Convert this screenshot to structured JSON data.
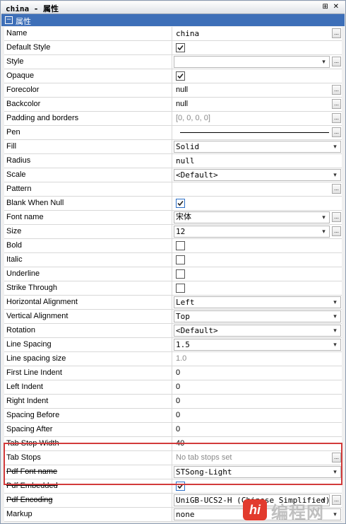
{
  "window": {
    "title": "china - 属性",
    "icons": "⊞ ✕"
  },
  "section": {
    "label": "属性"
  },
  "properties": [
    {
      "name": "Name",
      "kind": "text",
      "value": "china",
      "mono": true,
      "ellipsis": true
    },
    {
      "name": "Default Style",
      "kind": "check",
      "checked": true
    },
    {
      "name": "Style",
      "kind": "combo",
      "value": "",
      "ellipsis": true
    },
    {
      "name": "Opaque",
      "kind": "check",
      "checked": true
    },
    {
      "name": "Forecolor",
      "kind": "text",
      "value": "null",
      "ellipsis": true
    },
    {
      "name": "Backcolor",
      "kind": "text",
      "value": "null",
      "ellipsis": true
    },
    {
      "name": "Padding and borders",
      "kind": "text",
      "value": "[0, 0, 0, 0]",
      "gray": true,
      "ellipsis": true
    },
    {
      "name": "Pen",
      "kind": "pen",
      "ellipsis": true
    },
    {
      "name": "Fill",
      "kind": "combo",
      "value": "Solid",
      "mono": true
    },
    {
      "name": "Radius",
      "kind": "text",
      "value": "null",
      "mono": true
    },
    {
      "name": "Scale",
      "kind": "combo",
      "value": "<Default>",
      "mono": true
    },
    {
      "name": "Pattern",
      "kind": "text",
      "value": "",
      "ellipsis": true
    },
    {
      "name": "Blank When Null",
      "kind": "check",
      "checked": true,
      "blue": true
    },
    {
      "name": "Font name",
      "kind": "combo",
      "value": "宋体",
      "ellipsis": true
    },
    {
      "name": "Size",
      "kind": "combo",
      "value": "12",
      "mono": true,
      "ellipsis": true
    },
    {
      "name": "Bold",
      "kind": "check",
      "checked": false
    },
    {
      "name": "Italic",
      "kind": "check",
      "checked": false
    },
    {
      "name": "Underline",
      "kind": "check",
      "checked": false
    },
    {
      "name": "Strike Through",
      "kind": "check",
      "checked": false
    },
    {
      "name": "Horizontal Alignment",
      "kind": "combo",
      "value": "Left",
      "mono": true
    },
    {
      "name": "Vertical Alignment",
      "kind": "combo",
      "value": "Top",
      "mono": true
    },
    {
      "name": "Rotation",
      "kind": "combo",
      "value": "<Default>",
      "mono": true
    },
    {
      "name": "Line Spacing",
      "kind": "combo",
      "value": "1.5",
      "mono": true
    },
    {
      "name": "Line spacing size",
      "kind": "text",
      "value": "1.0",
      "gray": true
    },
    {
      "name": "First Line Indent",
      "kind": "text",
      "value": "0"
    },
    {
      "name": "Left Indent",
      "kind": "text",
      "value": "0"
    },
    {
      "name": "Right Indent",
      "kind": "text",
      "value": "0"
    },
    {
      "name": "Spacing Before",
      "kind": "text",
      "value": "0"
    },
    {
      "name": "Spacing After",
      "kind": "text",
      "value": "0"
    },
    {
      "name": "Tab Stop Width",
      "kind": "text",
      "value": "40"
    },
    {
      "name": "Tab Stops",
      "kind": "text",
      "value": "No tab stops set",
      "gray": true,
      "ellipsis": true
    },
    {
      "name": "Pdf Font name",
      "kind": "combo",
      "value": "STSong-Light",
      "mono": true,
      "strike": true
    },
    {
      "name": "Pdf Embedded",
      "kind": "check",
      "checked": true,
      "blue": true,
      "strike": true
    },
    {
      "name": "Pdf Encoding",
      "kind": "combo",
      "value": "UniGB-UCS2-H (Chinese Simplified)",
      "mono": true,
      "ellipsis": true,
      "strike": true
    },
    {
      "name": "Markup",
      "kind": "combo",
      "value": "none",
      "mono": true
    }
  ],
  "watermark": {
    "logo": "hi",
    "text": "编程网"
  },
  "colors": {
    "section_bg": "#3d6fb8",
    "highlight": "#d23b3b"
  }
}
